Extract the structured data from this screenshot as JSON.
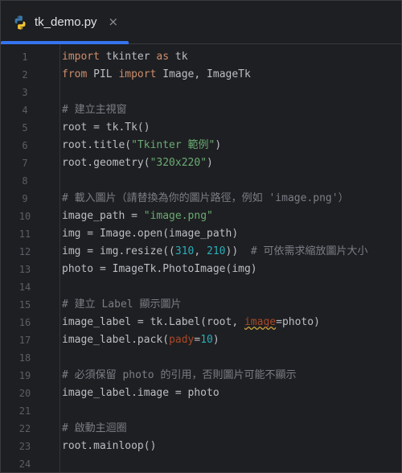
{
  "tab": {
    "filename": "tk_demo.py",
    "close_glyph": "×",
    "icon": "python-icon"
  },
  "colors": {
    "background": "#1e1f22",
    "accent": "#3574f0",
    "keyword": "#cf8e6d",
    "string": "#6aab73",
    "number": "#2aacb8",
    "comment": "#7a7e85",
    "parameter": "#aa4926",
    "text": "#bcbec4"
  },
  "lines": [
    [
      [
        "kw",
        "import"
      ],
      [
        "t",
        " tkinter "
      ],
      [
        "kw",
        "as"
      ],
      [
        "t",
        " tk"
      ]
    ],
    [
      [
        "kw",
        "from"
      ],
      [
        "t",
        " PIL "
      ],
      [
        "kw",
        "import"
      ],
      [
        "t",
        " Image, ImageTk"
      ]
    ],
    [],
    [
      [
        "com",
        "# 建立主視窗"
      ]
    ],
    [
      [
        "t",
        "root = tk.Tk()"
      ]
    ],
    [
      [
        "t",
        "root.title("
      ],
      [
        "str",
        "\"Tkinter 範例\""
      ],
      [
        "t",
        ")"
      ]
    ],
    [
      [
        "t",
        "root.geometry("
      ],
      [
        "str",
        "\"320x220\""
      ],
      [
        "t",
        ")"
      ]
    ],
    [],
    [
      [
        "com",
        "# 載入圖片（請替換為你的圖片路徑，例如 'image.png'）"
      ]
    ],
    [
      [
        "t",
        "image_path = "
      ],
      [
        "str",
        "\"image.png\""
      ]
    ],
    [
      [
        "t",
        "img = Image.open(image_path)"
      ]
    ],
    [
      [
        "t",
        "img = img.resize(("
      ],
      [
        "num",
        "310"
      ],
      [
        "t",
        ", "
      ],
      [
        "num",
        "210"
      ],
      [
        "t",
        "))  "
      ],
      [
        "com",
        "# 可依需求縮放圖片大小"
      ]
    ],
    [
      [
        "t",
        "photo = ImageTk.PhotoImage(img)"
      ]
    ],
    [],
    [
      [
        "com",
        "# 建立 Label 顯示圖片"
      ]
    ],
    [
      [
        "t",
        "image_label = tk.Label(root, "
      ],
      [
        "paramw",
        "image"
      ],
      [
        "t",
        "=photo)"
      ]
    ],
    [
      [
        "t",
        "image_label.pack("
      ],
      [
        "param",
        "pady"
      ],
      [
        "t",
        "="
      ],
      [
        "num",
        "10"
      ],
      [
        "t",
        ")"
      ]
    ],
    [],
    [
      [
        "com",
        "# 必須保留 photo 的引用，否則圖片可能不顯示"
      ]
    ],
    [
      [
        "t",
        "image_label.image = photo"
      ]
    ],
    [],
    [
      [
        "com",
        "# 啟動主迴圈"
      ]
    ],
    [
      [
        "t",
        "root.mainloop()"
      ]
    ],
    []
  ]
}
